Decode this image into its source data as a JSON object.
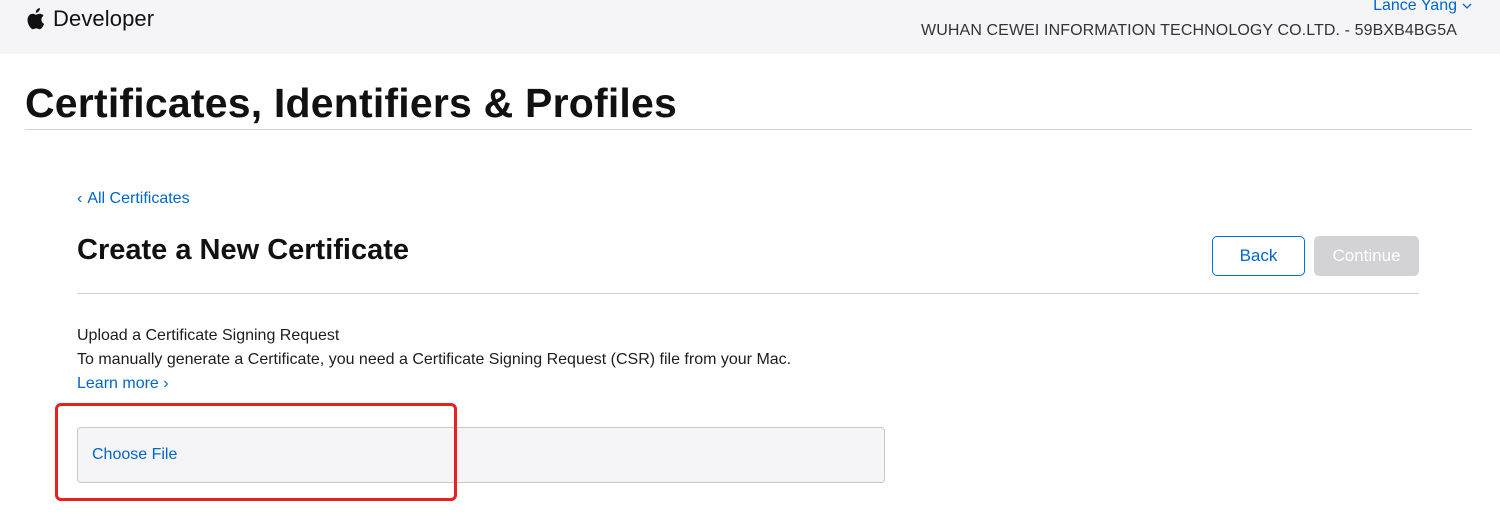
{
  "header": {
    "brand": "Developer",
    "user_name": "Lance Yang",
    "team_name": "WUHAN CEWEI INFORMATION TECHNOLOGY CO.LTD. - 59BXB4BG5A",
    "icons": [
      "apple-icon",
      "chevron-down-icon"
    ]
  },
  "page": {
    "title": "Certificates, Identifiers & Profiles"
  },
  "content": {
    "back_link": "All Certificates",
    "section_title": "Create a New Certificate",
    "back_button": "Back",
    "continue_button": "Continue",
    "continue_disabled": true,
    "upload_heading": "Upload a Certificate Signing Request",
    "upload_description": "To manually generate a Certificate, you need a Certificate Signing Request (CSR) file from your Mac.",
    "learn_more": "Learn more",
    "choose_file": "Choose File"
  },
  "colors": {
    "link": "#0066cc",
    "topbar_bg": "#f5f5f7",
    "disabled_button": "#d2d2d7",
    "annotation_red": "#e8201f"
  }
}
